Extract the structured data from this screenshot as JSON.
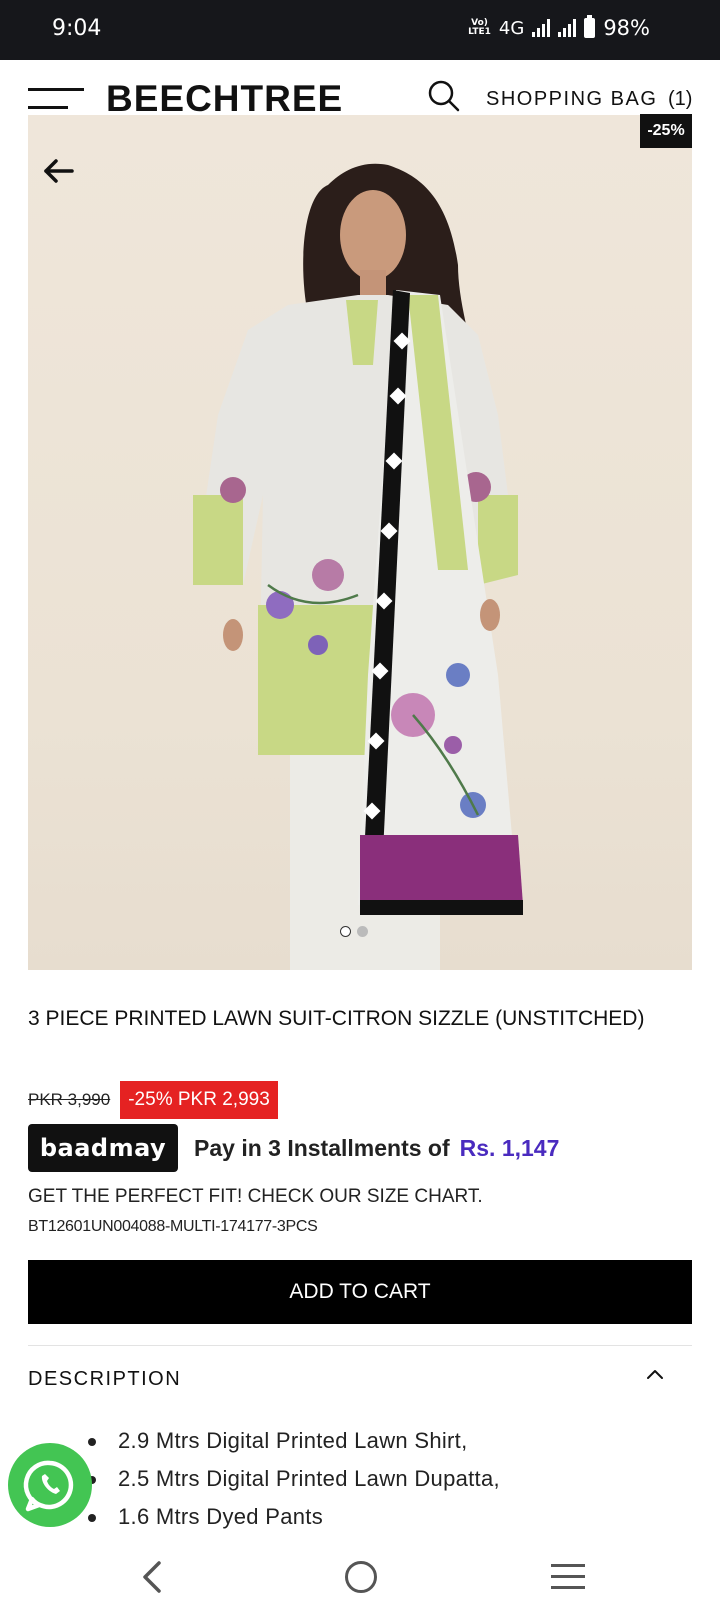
{
  "status_bar": {
    "time": "9:04",
    "volte": "VoLTE1",
    "network": "4G",
    "battery": "98%"
  },
  "header": {
    "brand": "BEECHTREE",
    "bag_label": "SHOPPING BAG",
    "bag_count": "(1)"
  },
  "product": {
    "discount_badge": "-25%",
    "title": "3 PIECE PRINTED LAWN SUIT-CITRON SIZZLE (UNSTITCHED)",
    "old_price": "PKR 3,990",
    "sale_discount": "-25%",
    "sale_price": "PKR 2,993",
    "baadmay_logo": "baadmay",
    "installments_text": "Pay in 3 Installments of",
    "installment_amount": "Rs. 1,147",
    "size_chart_text": "GET THE PERFECT FIT! CHECK OUR SIZE CHART.",
    "sku": "BT12601UN004088-MULTI-174177-3PCS",
    "add_to_cart": "ADD TO CART",
    "gallery_total": 2,
    "gallery_current": 1
  },
  "description": {
    "label": "DESCRIPTION",
    "items": [
      "2.9 Mtrs Digital Printed Lawn Shirt,",
      "2.5 Mtrs Digital Printed Lawn Dupatta,",
      "1.6 Mtrs Dyed Pants"
    ]
  },
  "colors": {
    "sale_red": "#e52222",
    "installment_purple": "#4a2bbf",
    "whatsapp_green": "#43c553",
    "status_bar": "#16171b"
  },
  "icons": [
    "hamburger-icon",
    "search-icon",
    "back-arrow-icon",
    "chevron-up-icon",
    "whatsapp-icon",
    "nav-back-icon",
    "nav-home-icon",
    "nav-menu-icon"
  ]
}
